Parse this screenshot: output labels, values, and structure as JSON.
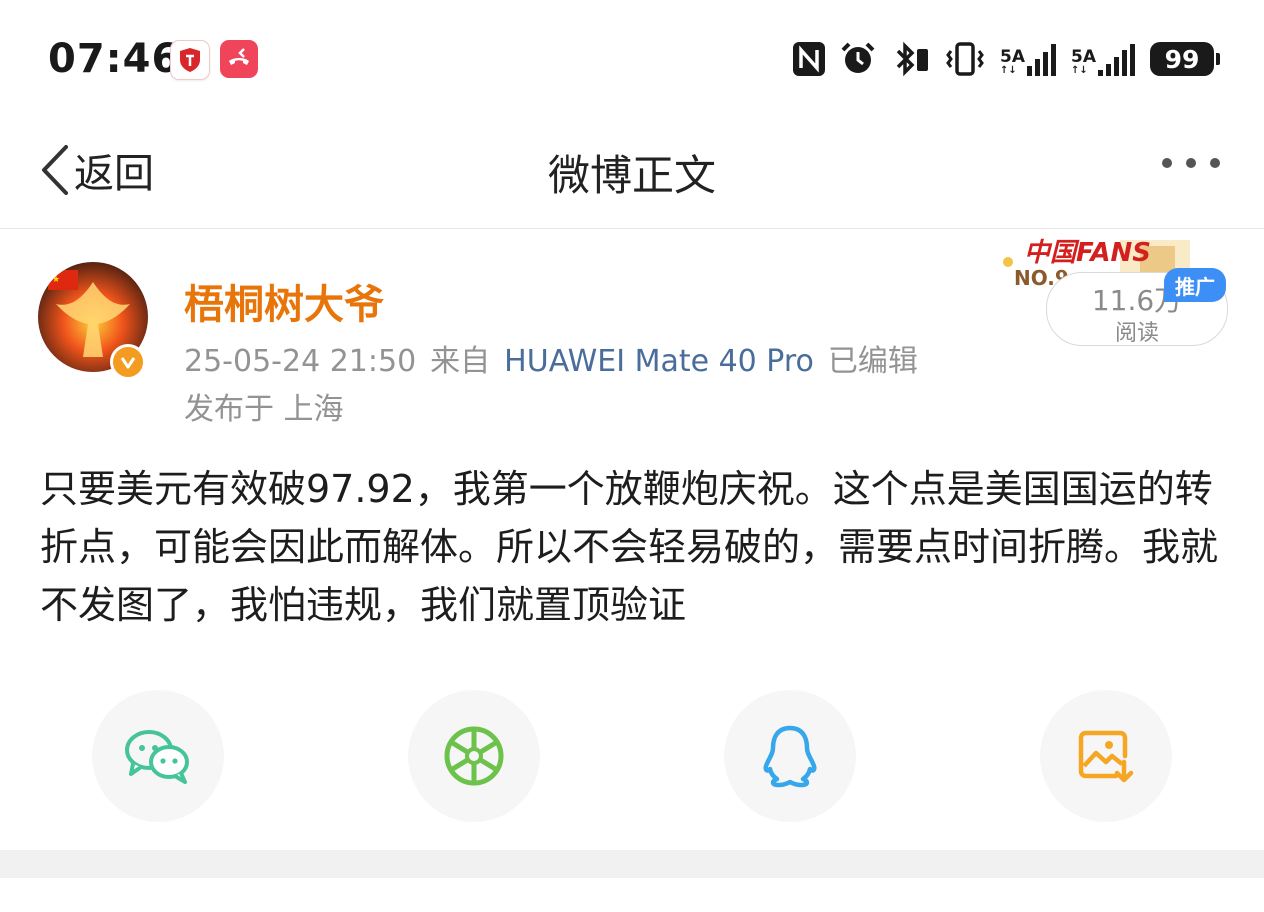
{
  "status_bar": {
    "time": "07:46",
    "network_1": "5A",
    "network_2": "5A",
    "battery": "99",
    "icons": [
      "shield-app-icon",
      "phone-app-icon",
      "nfc-icon",
      "alarm-icon",
      "bluetooth-icon",
      "vibrate-icon",
      "signal-icon",
      "signal-icon",
      "battery-icon"
    ]
  },
  "nav": {
    "back_label": "返回",
    "title": "微博正文"
  },
  "post": {
    "username": "梧桐树大爷",
    "timestamp": "25-05-24 21:50",
    "source_prefix": "来自",
    "device": "HUAWEI Mate 40 Pro",
    "edited": "已编辑",
    "location": "发布于 上海",
    "read_count": "11.6万",
    "read_label": "阅读",
    "promo_tag": "推广",
    "fans_badge_title": "中国FANS",
    "fans_badge_no": "NO.9",
    "body": "只要美元有效破97.92，我第一个放鞭炮庆祝。这个点是美国国运的转折点，可能会因此而解体。所以不会轻易破的，需要点时间折腾。我就不发图了，我怕违规，我们就置顶验证"
  },
  "share": {
    "items": [
      "wechat-icon",
      "moments-icon",
      "qq-icon",
      "save-image-icon"
    ]
  },
  "colors": {
    "username": "#e8750a",
    "device_link": "#4a6d9a",
    "meta_gray": "#939393",
    "wechat": "#45c39a",
    "moments": "#6cc24a",
    "qq": "#36a7ea",
    "save": "#f5a623",
    "promo": "#3d8ff5"
  }
}
